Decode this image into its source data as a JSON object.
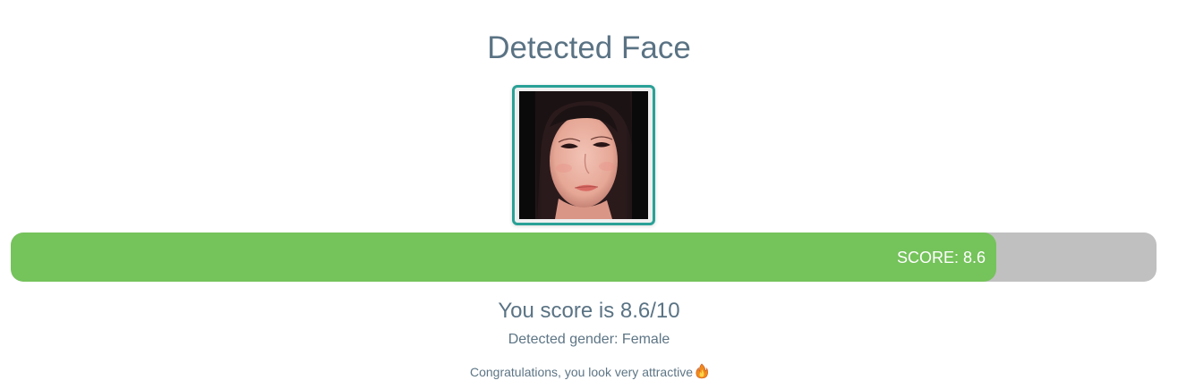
{
  "page": {
    "title": "Detected Face"
  },
  "face_image": {
    "icon": "detected-face-photo"
  },
  "score_bar": {
    "label": "SCORE: 8.6",
    "value": 8.6,
    "max": 10,
    "fill_fraction": 0.86,
    "fill_color": "#75c35b",
    "track_color": "#c0c0c0"
  },
  "result": {
    "score_text": "You score is 8.6/10",
    "gender_text": "Detected gender: Female",
    "message": "Congratulations, you look very attractive",
    "message_icon": "fire-icon"
  },
  "colors": {
    "accent_border": "#2aa197",
    "text": "#5d7585"
  }
}
